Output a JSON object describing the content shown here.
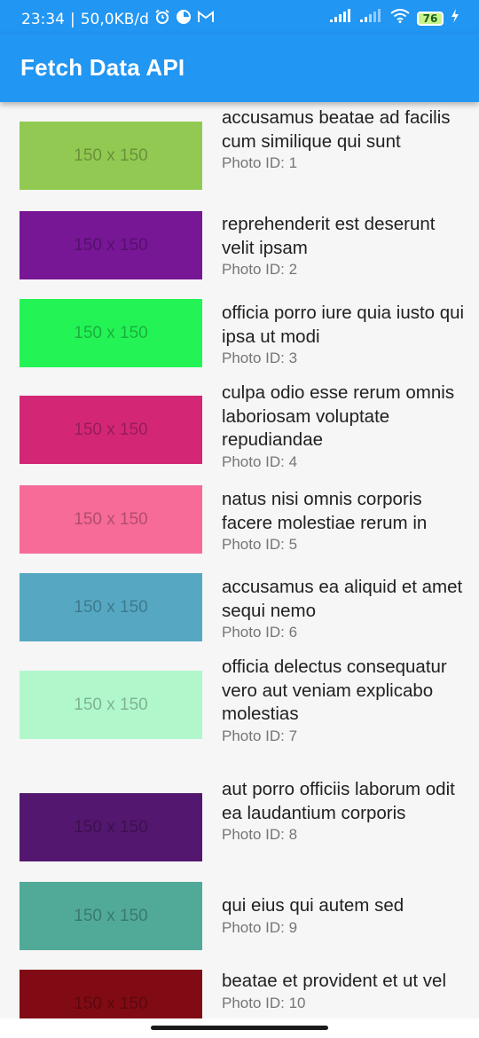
{
  "status_bar": {
    "time": "23:34",
    "separator": "|",
    "network_speed": "50,0KB/d",
    "notification_icons": [
      "alarm-icon",
      "pie-icon",
      "gmail-icon"
    ],
    "right_icons": [
      "signal-icon",
      "signal-icon",
      "wifi-icon",
      "battery-icon",
      "charging-icon"
    ],
    "battery_level": "76"
  },
  "app_bar": {
    "title": "Fetch Data API",
    "color": "#2196f3"
  },
  "photos": [
    {
      "title": "accusamus beatae ad facilis cum similique qui sunt",
      "id_label": "Photo ID: 1",
      "thumb_text": "150 x 150",
      "color": "#92c952"
    },
    {
      "title": "reprehenderit est deserunt velit ipsam",
      "id_label": "Photo ID: 2",
      "thumb_text": "150 x 150",
      "color": "#771796"
    },
    {
      "title": "officia porro iure quia iusto qui ipsa ut modi",
      "id_label": "Photo ID: 3",
      "thumb_text": "150 x 150",
      "color": "#24f355"
    },
    {
      "title": "culpa odio esse rerum omnis laboriosam voluptate repudiandae",
      "id_label": "Photo ID: 4",
      "thumb_text": "150 x 150",
      "color": "#d32776"
    },
    {
      "title": "natus nisi omnis corporis facere molestiae rerum in",
      "id_label": "Photo ID: 5",
      "thumb_text": "150 x 150",
      "color": "#f66b97"
    },
    {
      "title": "accusamus ea aliquid et amet sequi nemo",
      "id_label": "Photo ID: 6",
      "thumb_text": "150 x 150",
      "color": "#56a8c2"
    },
    {
      "title": "officia delectus consequatur vero aut veniam explicabo molestias",
      "id_label": "Photo ID: 7",
      "thumb_text": "150 x 150",
      "color": "#b0f7cc"
    },
    {
      "title": "aut porro officiis laborum odit ea laudantium corporis",
      "id_label": "Photo ID: 8",
      "thumb_text": "150 x 150",
      "color": "#54176f"
    },
    {
      "title": "qui eius qui autem sed",
      "id_label": "Photo ID: 9",
      "thumb_text": "150 x 150",
      "color": "#51aa97"
    },
    {
      "title": "beatae et provident et ut vel",
      "id_label": "Photo ID: 10",
      "thumb_text": "150 x 150",
      "color": "#810b14"
    }
  ]
}
